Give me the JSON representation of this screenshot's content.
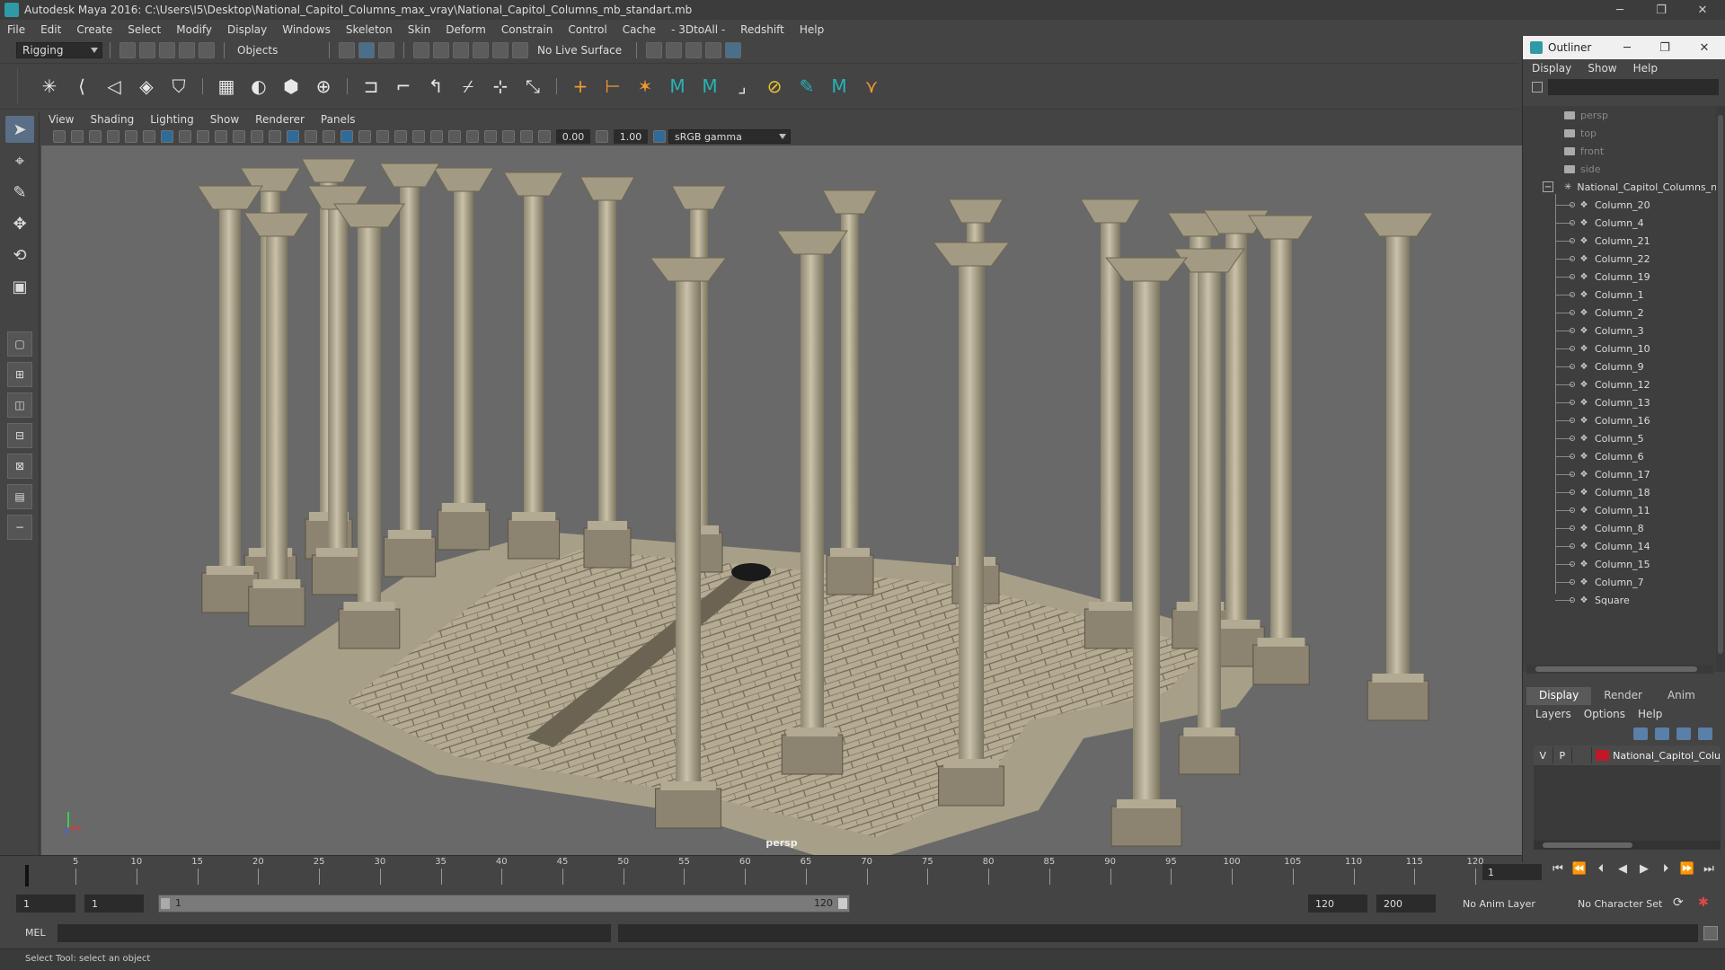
{
  "window": {
    "title": "Autodesk Maya 2016: C:\\Users\\I5\\Desktop\\National_Capitol_Columns_max_vray\\National_Capitol_Columns_mb_standart.mb",
    "minimize": "─",
    "maximize": "❐",
    "close": "✕"
  },
  "menubar": [
    "File",
    "Edit",
    "Create",
    "Select",
    "Modify",
    "Display",
    "Windows",
    "Skeleton",
    "Skin",
    "Deform",
    "Constrain",
    "Control",
    "Cache",
    "- 3DtoAll -",
    "Redshift",
    "Help"
  ],
  "statusline": {
    "menu_set": "Rigging",
    "selection_mode": "Objects",
    "live_surface": "No Live Surface"
  },
  "viewport": {
    "panel_menu": [
      "View",
      "Shading",
      "Lighting",
      "Show",
      "Renderer",
      "Panels"
    ],
    "exposure": "0.00",
    "gamma": "1.00",
    "color_space": "sRGB gamma",
    "camera_label": "persp"
  },
  "outliner": {
    "title": "Outliner",
    "menu": [
      "Display",
      "Show",
      "Help"
    ],
    "cameras": [
      "persp",
      "top",
      "front",
      "side"
    ],
    "group": "National_Capitol_Columns_n",
    "group_toggle": "−",
    "children": [
      "Column_20",
      "Column_4",
      "Column_21",
      "Column_22",
      "Column_19",
      "Column_1",
      "Column_2",
      "Column_3",
      "Column_10",
      "Column_9",
      "Column_12",
      "Column_13",
      "Column_16",
      "Column_5",
      "Column_6",
      "Column_17",
      "Column_18",
      "Column_11",
      "Column_8",
      "Column_14",
      "Column_15",
      "Column_7",
      "Square"
    ]
  },
  "layers": {
    "tabs": [
      "Display",
      "Render",
      "Anim"
    ],
    "menu": [
      "Layers",
      "Options",
      "Help"
    ],
    "rows": [
      {
        "v": "V",
        "p": "P",
        "name": "National_Capitol_Colu",
        "color": "#c01828"
      }
    ]
  },
  "timeline": {
    "ticks": [
      1,
      5,
      10,
      15,
      20,
      25,
      30,
      35,
      40,
      45,
      50,
      55,
      60,
      65,
      70,
      75,
      80,
      85,
      90,
      95,
      100,
      105,
      110,
      115,
      120
    ],
    "current_frame": "1"
  },
  "range": {
    "start": "1",
    "anim_start": "1",
    "slider_start": "1",
    "slider_end": "120",
    "anim_end": "120",
    "end": "200",
    "anim_layer": "No Anim Layer",
    "character_set": "No Character Set"
  },
  "cmdline": {
    "label": "MEL"
  },
  "helpline": {
    "text": "Select Tool: select an object"
  },
  "colors": {
    "viewport_bg": "#696969",
    "ui_bg": "#444444",
    "field_bg": "#2b2b2b",
    "accent": "#2f9aa6"
  }
}
